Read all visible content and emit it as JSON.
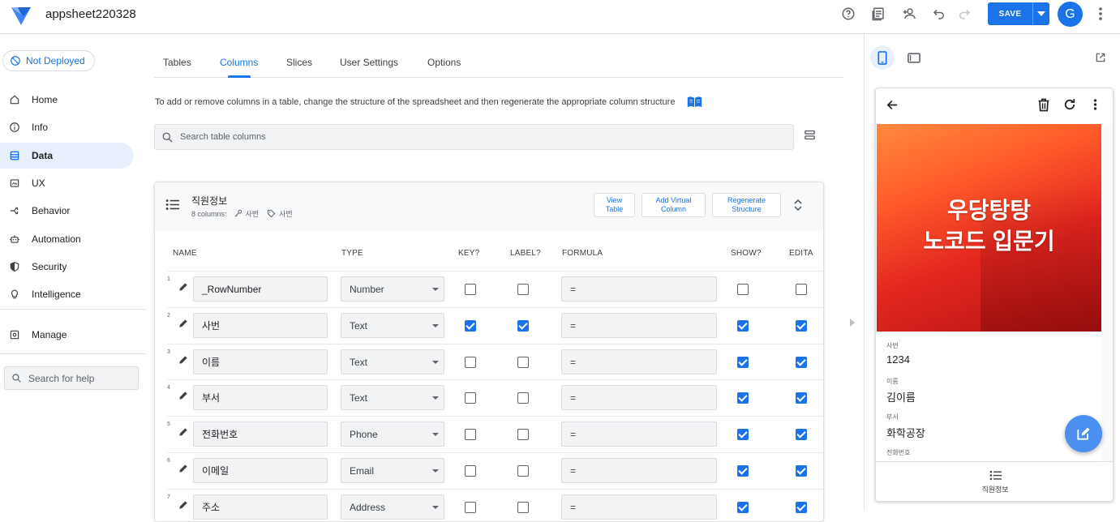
{
  "app": {
    "name": "appsheet220328",
    "brand_color": "#1a73e8"
  },
  "toolbar": {
    "save_label": "SAVE",
    "avatar_letter": "G"
  },
  "sidebar": {
    "deploy_label": "Not Deployed",
    "items": [
      {
        "label": "Home",
        "icon": "home-icon"
      },
      {
        "label": "Info",
        "icon": "info-icon"
      },
      {
        "label": "Data",
        "icon": "data-icon",
        "active": true
      },
      {
        "label": "UX",
        "icon": "ux-icon"
      },
      {
        "label": "Behavior",
        "icon": "behavior-icon"
      },
      {
        "label": "Automation",
        "icon": "automation-icon"
      },
      {
        "label": "Security",
        "icon": "shield-icon"
      },
      {
        "label": "Intelligence",
        "icon": "lightbulb-icon"
      },
      {
        "label": "Manage",
        "icon": "manage-icon"
      }
    ],
    "help_placeholder": "Search for help"
  },
  "tabs": [
    "Tables",
    "Columns",
    "Slices",
    "User Settings",
    "Options"
  ],
  "active_tab": "Columns",
  "info_text": "To add or remove columns in a table, change the structure of the spreadsheet and then regenerate the appropriate column structure",
  "column_search_placeholder": "Search table columns",
  "table": {
    "title": "직원정보",
    "columns_count": "8 columns:",
    "key_label": "사번",
    "label_label": "사번",
    "buttons": {
      "view": "View Table",
      "add_virtual": "Add Virtual Column",
      "regenerate": "Regenerate Structure"
    },
    "headers": {
      "name": "NAME",
      "type": "TYPE",
      "key": "KEY?",
      "label": "LABEL?",
      "formula": "FORMULA",
      "show": "SHOW?",
      "editable": "EDITA"
    },
    "rows": [
      {
        "num": "1",
        "name": "_RowNumber",
        "type": "Number",
        "key": false,
        "label": false,
        "formula": "=",
        "show": false,
        "editable": false
      },
      {
        "num": "2",
        "name": "사번",
        "type": "Text",
        "key": true,
        "label": true,
        "formula": "=",
        "show": true,
        "editable": true
      },
      {
        "num": "3",
        "name": "이름",
        "type": "Text",
        "key": false,
        "label": false,
        "formula": "=",
        "show": true,
        "editable": true
      },
      {
        "num": "4",
        "name": "부서",
        "type": "Text",
        "key": false,
        "label": false,
        "formula": "=",
        "show": true,
        "editable": true
      },
      {
        "num": "5",
        "name": "전화번호",
        "type": "Phone",
        "key": false,
        "label": false,
        "formula": "=",
        "show": true,
        "editable": true
      },
      {
        "num": "6",
        "name": "이메일",
        "type": "Email",
        "key": false,
        "label": false,
        "formula": "=",
        "show": true,
        "editable": true
      },
      {
        "num": "7",
        "name": "주소",
        "type": "Address",
        "key": false,
        "label": false,
        "formula": "=",
        "show": true,
        "editable": true
      }
    ]
  },
  "preview": {
    "hero_line1": "우당탕탕",
    "hero_line2": "노코드 입문기",
    "fields": [
      {
        "label": "사번",
        "value": "1234"
      },
      {
        "label": "이름",
        "value": "김이름"
      },
      {
        "label": "부서",
        "value": "화학공장"
      },
      {
        "label": "전화번호",
        "value": ""
      }
    ],
    "nav_label": "직원정보"
  }
}
